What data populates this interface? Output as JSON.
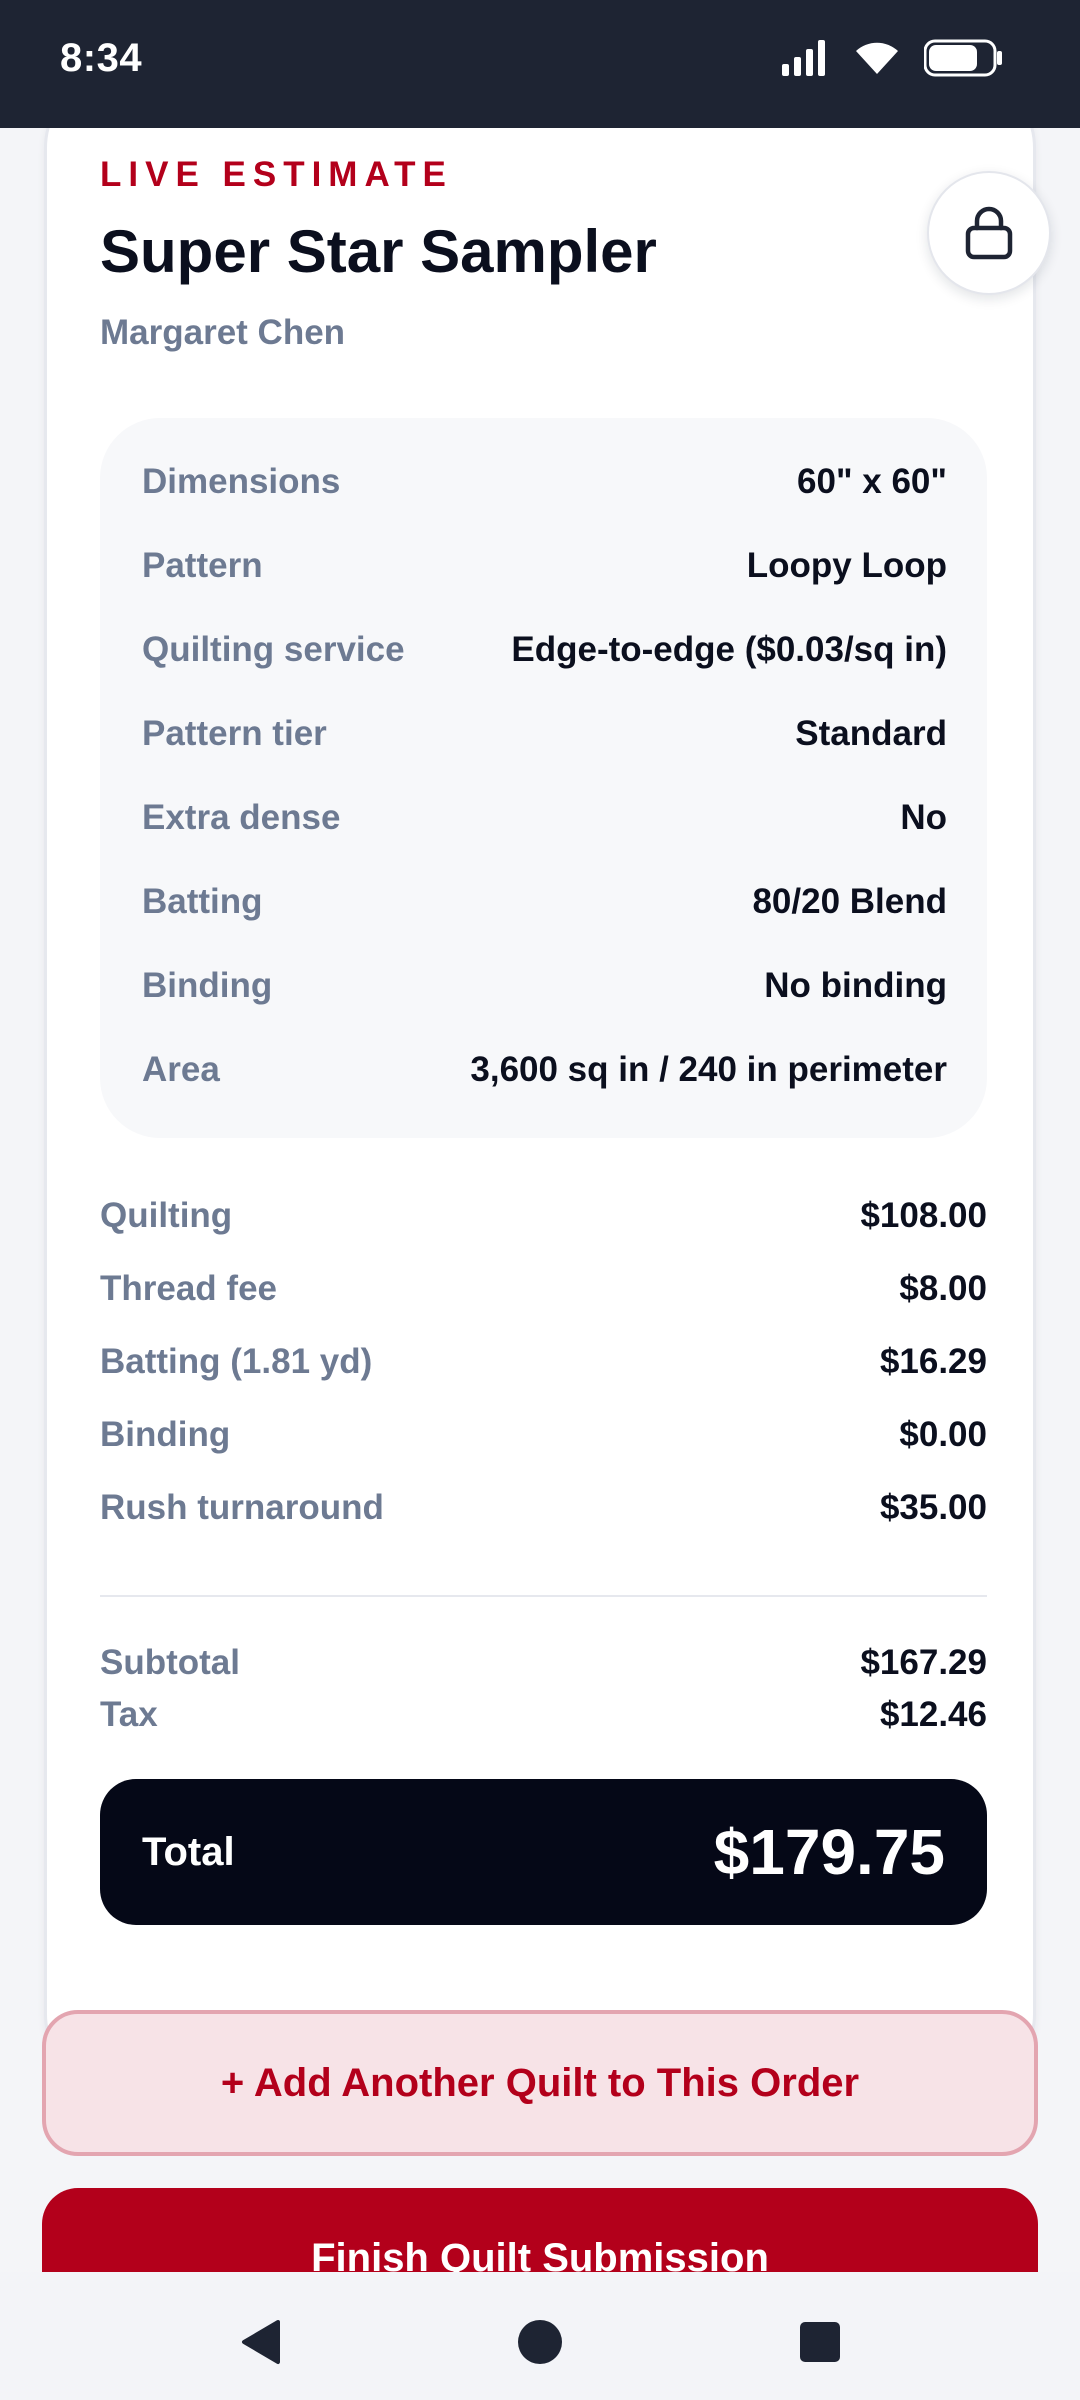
{
  "status_bar": {
    "time": "8:34",
    "icons": [
      "signal-icon",
      "wifi-icon",
      "battery-icon"
    ]
  },
  "estimate": {
    "eyebrow": "LIVE ESTIMATE",
    "title": "Super Star Sampler",
    "customer": "Margaret Chen",
    "lock_icon": "lock-icon",
    "details": [
      {
        "label": "Dimensions",
        "value": "60\" x 60\""
      },
      {
        "label": "Pattern",
        "value": "Loopy Loop"
      },
      {
        "label": "Quilting service",
        "value": "Edge-to-edge ($0.03/sq in)"
      },
      {
        "label": "Pattern tier",
        "value": "Standard"
      },
      {
        "label": "Extra dense",
        "value": "No"
      },
      {
        "label": "Batting",
        "value": "80/20 Blend"
      },
      {
        "label": "Binding",
        "value": "No binding"
      },
      {
        "label": "Area",
        "value": "3,600 sq in / 240 in perimeter"
      }
    ],
    "costs": [
      {
        "label": "Quilting",
        "value": "$108.00"
      },
      {
        "label": "Thread fee",
        "value": "$8.00"
      },
      {
        "label": "Batting (1.81 yd)",
        "value": "$16.29"
      },
      {
        "label": "Binding",
        "value": "$0.00"
      },
      {
        "label": "Rush turnaround",
        "value": "$35.00"
      }
    ],
    "subtotal": {
      "label": "Subtotal",
      "value": "$167.29"
    },
    "tax": {
      "label": "Tax",
      "value": "$12.46"
    },
    "total": {
      "label": "Total",
      "value": "$179.75"
    }
  },
  "actions": {
    "add_quilt": "+ Add Another Quilt to This Order",
    "finish": "Finish Quilt Submission"
  },
  "colors": {
    "accent": "#b3001b",
    "dark": "#050817",
    "muted": "#6d7a92"
  }
}
